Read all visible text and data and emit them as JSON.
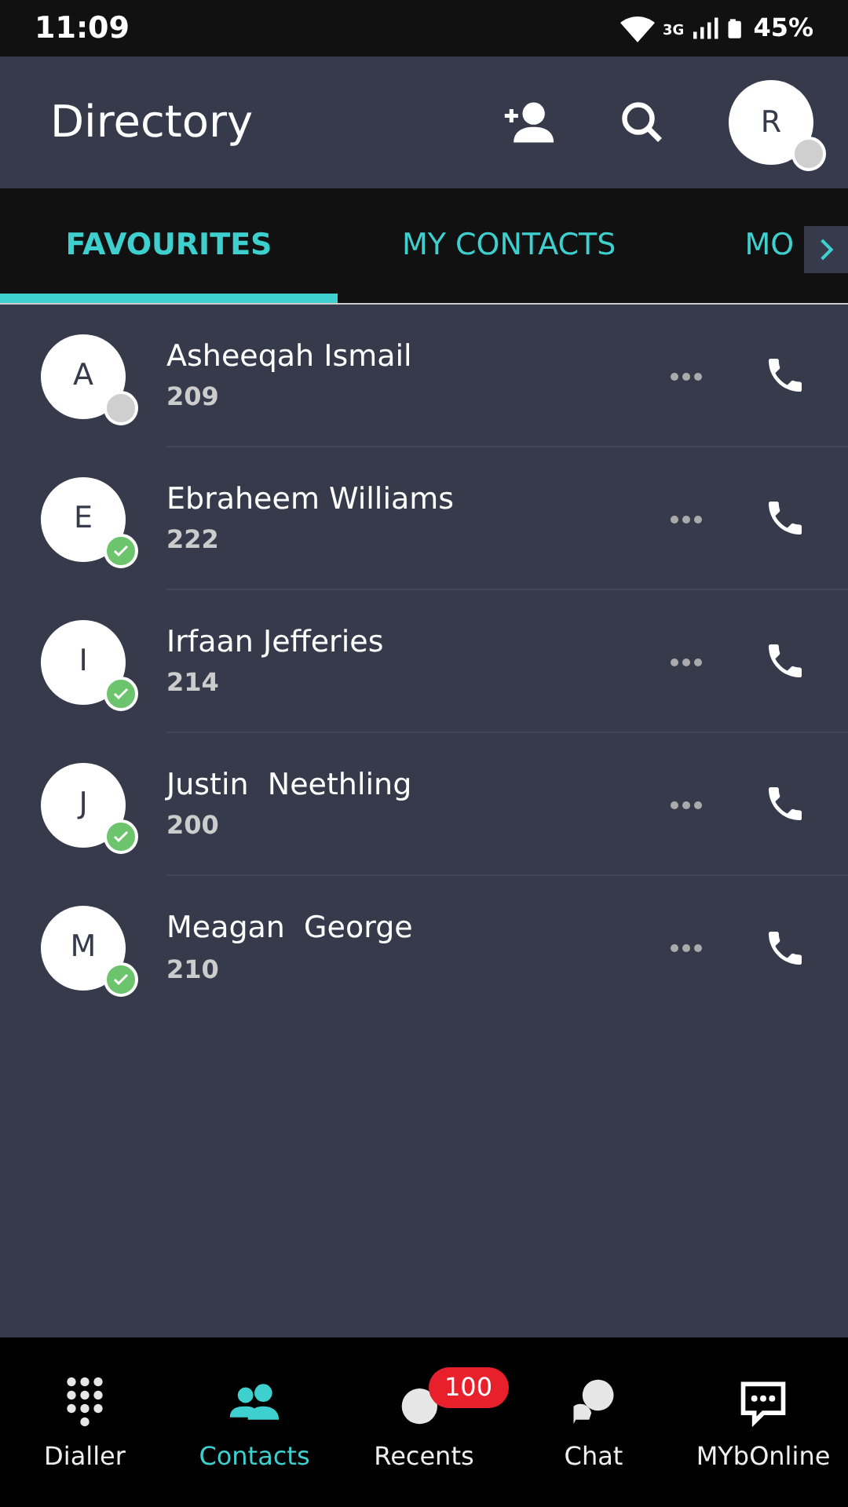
{
  "status_bar": {
    "time": "11:09",
    "network": "3G",
    "battery": "45%"
  },
  "header": {
    "title": "Directory",
    "avatar": {
      "initial": "R",
      "available": false
    }
  },
  "tabs": [
    {
      "label": "FAVOURITES",
      "selected": true
    },
    {
      "label": "MY CONTACTS",
      "selected": false
    },
    {
      "label": "MO",
      "selected": false
    }
  ],
  "contacts": [
    {
      "initial": "A",
      "name": "Asheeqah Ismail",
      "extension": "209",
      "available": false
    },
    {
      "initial": "E",
      "name": "Ebraheem Williams",
      "extension": "222",
      "available": true
    },
    {
      "initial": "I",
      "name": "Irfaan Jefferies",
      "extension": "214",
      "available": true
    },
    {
      "initial": "J",
      "name": "Justin  Neethling",
      "extension": "200",
      "available": true
    },
    {
      "initial": "M",
      "name": "Meagan  George",
      "extension": "210",
      "available": true
    }
  ],
  "bottom_nav": [
    {
      "kind": "dialler",
      "label": "Dialler",
      "selected": false
    },
    {
      "kind": "contacts",
      "label": "Contacts",
      "selected": true
    },
    {
      "kind": "recents",
      "label": "Recents",
      "selected": false,
      "badge": "100"
    },
    {
      "kind": "chat",
      "label": "Chat",
      "selected": false
    },
    {
      "kind": "online",
      "label": "MYbOnline",
      "selected": false
    }
  ]
}
